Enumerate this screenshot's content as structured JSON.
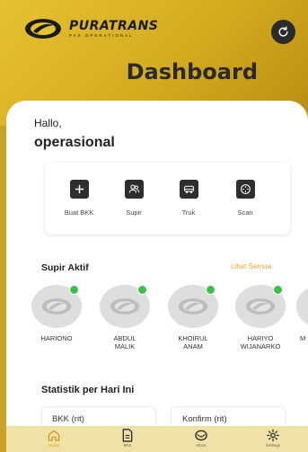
{
  "header": {
    "brand_name": "PURATRANS",
    "brand_sub": "PAS OPERATIONAL",
    "title": "Dashboard",
    "refresh_icon": "refresh-icon"
  },
  "greeting": {
    "hello": "Hallo,",
    "username": "operasional"
  },
  "menu": [
    {
      "label": "Buat BKK",
      "icon": "plus-icon"
    },
    {
      "label": "Supir",
      "icon": "users-icon"
    },
    {
      "label": "Truk",
      "icon": "truck-icon"
    },
    {
      "label": "Scan",
      "icon": "scan-icon"
    }
  ],
  "drivers_section": {
    "title": "Supir Aktif",
    "see_all": "Lihat Semua"
  },
  "drivers": [
    {
      "name": "HARIONO"
    },
    {
      "name": "ABDUL\nMALIK"
    },
    {
      "name": "KHOIRUL\nANAM"
    },
    {
      "name": "HARIYO\nWIJANARKO"
    },
    {
      "name": "M"
    }
  ],
  "stats": {
    "title": "Statistik per Hari Ini",
    "bkk_label": "BKK (rit)",
    "konfirm_label": "Konfirm (rit)"
  },
  "bottom_nav": [
    {
      "label": "Home",
      "icon": "home-icon"
    },
    {
      "label": "BKK",
      "icon": "document-icon"
    },
    {
      "label": "Inbox",
      "icon": "inbox-icon"
    },
    {
      "label": "Settings",
      "icon": "settings-icon"
    }
  ],
  "colors": {
    "brand": "#d3ab1f",
    "accent": "#f2a72e",
    "online": "#3bbf4d"
  }
}
